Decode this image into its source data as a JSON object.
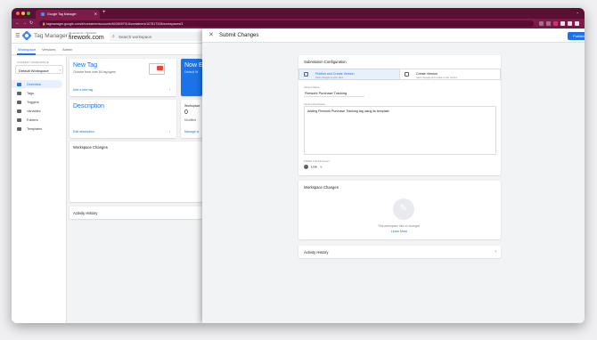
{
  "browser": {
    "tab_title": "Google Tag Manager",
    "url": "tagmanager.google.com/#/container/accounts/6028097016/containers/107817328/workspaces/3",
    "dot_colors": [
      "#ff5f57",
      "#febc2e",
      "#28c840"
    ]
  },
  "gtm": {
    "app_name": "Tag Manager",
    "account_line": "All accounts > Firework",
    "container_name": "firework.com",
    "search_placeholder": "Search workspace",
    "tabs": [
      "Workspace",
      "Versions",
      "Admin"
    ]
  },
  "sidebar": {
    "workspace_label": "CURRENT WORKSPACE",
    "workspace_name": "Default Workspace",
    "items": [
      {
        "label": "Overview",
        "active": true
      },
      {
        "label": "Tags",
        "active": false
      },
      {
        "label": "Triggers",
        "active": false
      },
      {
        "label": "Variables",
        "active": false
      },
      {
        "label": "Folders",
        "active": false
      },
      {
        "label": "Templates",
        "active": false
      }
    ]
  },
  "cards": {
    "new_tag_title": "New Tag",
    "new_tag_sub": "Choose from over 50 tag types",
    "new_tag_link": "Add a new tag",
    "now_editing_title": "Now E",
    "now_editing_sub": "Default W",
    "description_title": "Description",
    "description_link": "Edit description",
    "workspace_changes_label": "Workspace",
    "workspace_changes_count": "0",
    "modified_label": "Modified",
    "manage_link": "Manage w",
    "workspace_changes_head": "Workspace Changes",
    "activity_head": "Activity History"
  },
  "panel": {
    "title": "Submit Changes",
    "publish_button": "Publish",
    "submission_config_title": "Submission Configuration",
    "option1_title": "Publish and Create Version",
    "option1_sub": "Push changes to your sites",
    "option2_title": "Create Version",
    "option2_sub": "Save changes and create a new version",
    "version_name_label": "Version Name",
    "version_name_value": "Firework Purchase Tracking",
    "version_desc_label": "Version Description",
    "version_desc_value": "Adding Firework Purchase Tracking tag using its template",
    "env_label": "Publish to Environment",
    "env_value": "Live",
    "workspace_changes_title": "Workspace Changes",
    "empty_text": "This workspace has no changes.",
    "learn_more": "Learn More",
    "activity_title": "Activity History",
    "accent": "#1a73e8"
  }
}
